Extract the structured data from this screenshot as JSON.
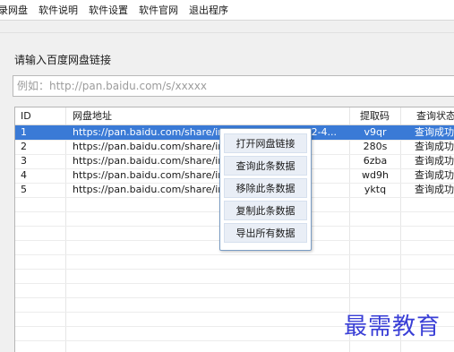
{
  "menu": {
    "items": [
      "录网盘",
      "软件说明",
      "软件设置",
      "软件官网",
      "退出程序"
    ]
  },
  "prompt_label": "请输入百度网盘链接",
  "url_input": {
    "value": "",
    "placeholder": "例如：http://pan.baidu.com/s/xxxxx"
  },
  "table": {
    "columns": [
      "ID",
      "网盘地址",
      "提取码",
      "查询状态"
    ],
    "rows": [
      {
        "id": "1",
        "url": "https://pan.baidu.com/share/init?surl=0-Q93c5Z2-4...",
        "code": "v9qr",
        "status": "查询成功",
        "selected": true
      },
      {
        "id": "2",
        "url": "https://pan.baidu.com/share/init?surl=...",
        "code": "280s",
        "status": "查询成功",
        "selected": false
      },
      {
        "id": "3",
        "url": "https://pan.baidu.com/share/init?surl=...",
        "code": "6zba",
        "status": "查询成功",
        "selected": false
      },
      {
        "id": "4",
        "url": "https://pan.baidu.com/share/init?surl=...",
        "code": "wd9h",
        "status": "查询成功",
        "selected": false
      },
      {
        "id": "5",
        "url": "https://pan.baidu.com/share/init?surl=...",
        "code": "yktq",
        "status": "查询成功",
        "selected": false
      }
    ]
  },
  "context_menu": {
    "items": [
      "打开网盘链接",
      "查询此条数据",
      "移除此条数据",
      "复制此条数据",
      "导出所有数据"
    ]
  },
  "watermark": "最需教育",
  "colors": {
    "selection": "#3a7ad6",
    "watermark": "#3a3fd6",
    "menu_border": "#7a9cc4"
  }
}
